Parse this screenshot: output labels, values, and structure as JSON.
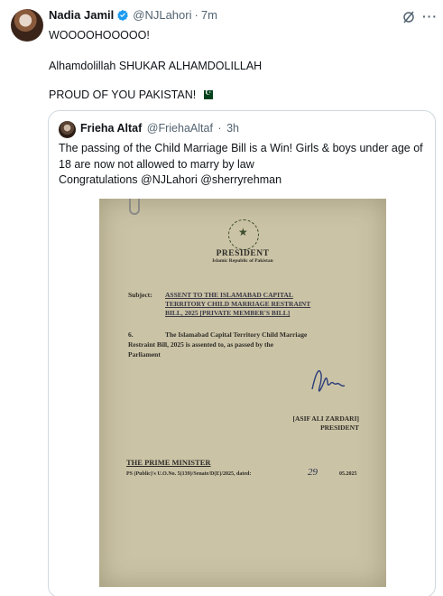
{
  "tweet": {
    "author_name": "Nadia Jamil",
    "handle": "@NJLahori",
    "separator": "·",
    "time": "7m",
    "lines": [
      "WOOOOHOOOOO!",
      "Alhamdolillah SHUKAR ALHAMDOLILLAH",
      "PROUD OF YOU PAKISTAN!"
    ]
  },
  "quote": {
    "author_name": "Frieha Altaf",
    "handle": "@FriehaAltaf",
    "separator": "·",
    "time": "3h",
    "lines": [
      "The  passing of the Child Marriage Bill is a Win! Girls & boys under age of",
      "18 are now not allowed to marry by law",
      " Congratulations @NJLahori @sherryrehman"
    ]
  },
  "document": {
    "title": "PRESIDENT",
    "subtitle": "Islamic Republic of Pakistan",
    "subject_label": "Subject:",
    "subject_lines": [
      "ASSENT    TO    THE    ISLAMABAD    CAPITAL",
      "TERRITORY  CHILD  MARRIAGE  RESTRAINT",
      "BILL, 2025 [PRIVATE MEMBER'S BILL]"
    ],
    "para_num": "6.",
    "body_lines": [
      "The Islamabad Capital Territory Child Marriage",
      "Restraint Bill, 2025 is assented to, as passed by the",
      "Parliament"
    ],
    "signatory_name": "[ASIF ALI ZARDARI]",
    "signatory_title": "PRESIDENT",
    "addressee": "THE PRIME MINISTER",
    "reference": "PS (Public)'s U.O.No. 5(139)/Senate/D(E)/2025, dated:",
    "date_handwritten": "29",
    "date_suffix": "05.2025"
  },
  "colors": {
    "verified": "#1d9bf0",
    "secondary_text": "#536471",
    "border": "#cfd9de",
    "paper": "#cbc3a6",
    "flag_green": "#01411c"
  },
  "icons": [
    "verified-badge-icon",
    "grok-icon",
    "more-icon",
    "pakistan-flag-icon"
  ]
}
